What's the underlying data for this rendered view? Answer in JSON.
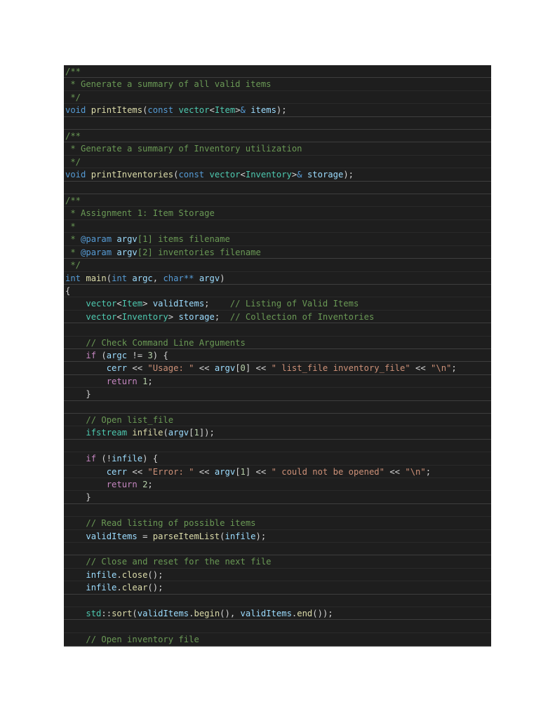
{
  "editor": {
    "language": "cpp",
    "theme_colors": {
      "background": "#1e1e1e",
      "comment": "#6a9955",
      "keyword": "#569cd6",
      "control": "#c586c0",
      "function": "#dcdcaa",
      "type": "#4ec9b0",
      "variable": "#9cdcfe",
      "string": "#ce9178",
      "number": "#b5cea8",
      "punctuation": "#d4d4d4"
    },
    "lines": [
      [
        [
          "comment",
          "/**"
        ]
      ],
      [
        [
          "comment",
          " * Generate a summary of all valid items"
        ]
      ],
      [
        [
          "comment",
          " */"
        ]
      ],
      [
        [
          "kw",
          "void"
        ],
        [
          "punct",
          " "
        ],
        [
          "fn",
          "printItems"
        ],
        [
          "punct",
          "("
        ],
        [
          "kw",
          "const"
        ],
        [
          "punct",
          " "
        ],
        [
          "type",
          "vector"
        ],
        [
          "punct",
          "<"
        ],
        [
          "type",
          "Item"
        ],
        [
          "punct",
          ">"
        ],
        [
          "kw",
          "&"
        ],
        [
          "punct",
          " "
        ],
        [
          "var",
          "items"
        ],
        [
          "punct",
          ");"
        ]
      ],
      [],
      [
        [
          "comment",
          "/**"
        ]
      ],
      [
        [
          "comment",
          " * Generate a summary of Inventory utilization"
        ]
      ],
      [
        [
          "comment",
          " */"
        ]
      ],
      [
        [
          "kw",
          "void"
        ],
        [
          "punct",
          " "
        ],
        [
          "fn",
          "printInventories"
        ],
        [
          "punct",
          "("
        ],
        [
          "kw",
          "const"
        ],
        [
          "punct",
          " "
        ],
        [
          "type",
          "vector"
        ],
        [
          "punct",
          "<"
        ],
        [
          "type",
          "Inventory"
        ],
        [
          "punct",
          ">"
        ],
        [
          "kw",
          "&"
        ],
        [
          "punct",
          " "
        ],
        [
          "var",
          "storage"
        ],
        [
          "punct",
          ");"
        ]
      ],
      [],
      [
        [
          "comment",
          "/**"
        ]
      ],
      [
        [
          "comment",
          " * Assignment 1: Item Storage"
        ]
      ],
      [
        [
          "comment",
          " *"
        ]
      ],
      [
        [
          "comment",
          " * "
        ],
        [
          "doc",
          "@param"
        ],
        [
          "punct",
          " "
        ],
        [
          "var",
          "argv"
        ],
        [
          "comment",
          "[1] items filename"
        ]
      ],
      [
        [
          "comment",
          " * "
        ],
        [
          "doc",
          "@param"
        ],
        [
          "punct",
          " "
        ],
        [
          "var",
          "argv"
        ],
        [
          "comment",
          "[2] inventories filename"
        ]
      ],
      [
        [
          "comment",
          " */"
        ]
      ],
      [
        [
          "kw",
          "int"
        ],
        [
          "punct",
          " "
        ],
        [
          "fn",
          "main"
        ],
        [
          "punct",
          "("
        ],
        [
          "kw",
          "int"
        ],
        [
          "punct",
          " "
        ],
        [
          "var",
          "argc"
        ],
        [
          "punct",
          ", "
        ],
        [
          "kw",
          "char**"
        ],
        [
          "punct",
          " "
        ],
        [
          "var",
          "argv"
        ],
        [
          "punct",
          ")"
        ]
      ],
      [
        [
          "punct",
          "{"
        ]
      ],
      [
        [
          "punct",
          "    "
        ],
        [
          "type",
          "vector"
        ],
        [
          "punct",
          "<"
        ],
        [
          "type",
          "Item"
        ],
        [
          "punct",
          "> "
        ],
        [
          "var",
          "validItems"
        ],
        [
          "punct",
          ";    "
        ],
        [
          "comment",
          "// Listing of Valid Items"
        ]
      ],
      [
        [
          "punct",
          "    "
        ],
        [
          "type",
          "vector"
        ],
        [
          "punct",
          "<"
        ],
        [
          "type",
          "Inventory"
        ],
        [
          "punct",
          "> "
        ],
        [
          "var",
          "storage"
        ],
        [
          "punct",
          ";  "
        ],
        [
          "comment",
          "// Collection of Inventories"
        ]
      ],
      [],
      [
        [
          "punct",
          "    "
        ],
        [
          "comment",
          "// Check Command Line Arguments"
        ]
      ],
      [
        [
          "punct",
          "    "
        ],
        [
          "ctrl",
          "if"
        ],
        [
          "punct",
          " ("
        ],
        [
          "var",
          "argc"
        ],
        [
          "punct",
          " != "
        ],
        [
          "num",
          "3"
        ],
        [
          "punct",
          ") {"
        ]
      ],
      [
        [
          "punct",
          "        "
        ],
        [
          "var",
          "cerr"
        ],
        [
          "punct",
          " << "
        ],
        [
          "str",
          "\"Usage: \""
        ],
        [
          "punct",
          " << "
        ],
        [
          "var",
          "argv"
        ],
        [
          "punct",
          "["
        ],
        [
          "num",
          "0"
        ],
        [
          "punct",
          "] << "
        ],
        [
          "str",
          "\" list_file inventory_file\""
        ],
        [
          "punct",
          " << "
        ],
        [
          "str",
          "\"\\n\""
        ],
        [
          "punct",
          ";"
        ]
      ],
      [
        [
          "punct",
          "        "
        ],
        [
          "ctrl",
          "return"
        ],
        [
          "punct",
          " "
        ],
        [
          "num",
          "1"
        ],
        [
          "punct",
          ";"
        ]
      ],
      [
        [
          "punct",
          "    }"
        ]
      ],
      [],
      [
        [
          "punct",
          "    "
        ],
        [
          "comment",
          "// Open list_file"
        ]
      ],
      [
        [
          "punct",
          "    "
        ],
        [
          "type",
          "ifstream"
        ],
        [
          "punct",
          " "
        ],
        [
          "fn",
          "infile"
        ],
        [
          "punct",
          "("
        ],
        [
          "var",
          "argv"
        ],
        [
          "punct",
          "["
        ],
        [
          "num",
          "1"
        ],
        [
          "punct",
          "]);"
        ]
      ],
      [],
      [
        [
          "punct",
          "    "
        ],
        [
          "ctrl",
          "if"
        ],
        [
          "punct",
          " (!"
        ],
        [
          "var",
          "infile"
        ],
        [
          "punct",
          ") {"
        ]
      ],
      [
        [
          "punct",
          "        "
        ],
        [
          "var",
          "cerr"
        ],
        [
          "punct",
          " << "
        ],
        [
          "str",
          "\"Error: \""
        ],
        [
          "punct",
          " << "
        ],
        [
          "var",
          "argv"
        ],
        [
          "punct",
          "["
        ],
        [
          "num",
          "1"
        ],
        [
          "punct",
          "] << "
        ],
        [
          "str",
          "\" could not be opened\""
        ],
        [
          "punct",
          " << "
        ],
        [
          "str",
          "\"\\n\""
        ],
        [
          "punct",
          ";"
        ]
      ],
      [
        [
          "punct",
          "        "
        ],
        [
          "ctrl",
          "return"
        ],
        [
          "punct",
          " "
        ],
        [
          "num",
          "2"
        ],
        [
          "punct",
          ";"
        ]
      ],
      [
        [
          "punct",
          "    }"
        ]
      ],
      [],
      [
        [
          "punct",
          "    "
        ],
        [
          "comment",
          "// Read listing of possible items"
        ]
      ],
      [
        [
          "punct",
          "    "
        ],
        [
          "var",
          "validItems"
        ],
        [
          "punct",
          " = "
        ],
        [
          "fn",
          "parseItemList"
        ],
        [
          "punct",
          "("
        ],
        [
          "var",
          "infile"
        ],
        [
          "punct",
          ");"
        ]
      ],
      [],
      [
        [
          "punct",
          "    "
        ],
        [
          "comment",
          "// Close and reset for the next file"
        ]
      ],
      [
        [
          "punct",
          "    "
        ],
        [
          "var",
          "infile"
        ],
        [
          "punct",
          "."
        ],
        [
          "fn",
          "close"
        ],
        [
          "punct",
          "();"
        ]
      ],
      [
        [
          "punct",
          "    "
        ],
        [
          "var",
          "infile"
        ],
        [
          "punct",
          "."
        ],
        [
          "fn",
          "clear"
        ],
        [
          "punct",
          "();"
        ]
      ],
      [],
      [
        [
          "punct",
          "    "
        ],
        [
          "type",
          "std"
        ],
        [
          "punct",
          "::"
        ],
        [
          "fn",
          "sort"
        ],
        [
          "punct",
          "("
        ],
        [
          "var",
          "validItems"
        ],
        [
          "punct",
          "."
        ],
        [
          "fn",
          "begin"
        ],
        [
          "punct",
          "(), "
        ],
        [
          "var",
          "validItems"
        ],
        [
          "punct",
          "."
        ],
        [
          "fn",
          "end"
        ],
        [
          "punct",
          "());"
        ]
      ],
      [],
      [
        [
          "punct",
          "    "
        ],
        [
          "comment",
          "// Open inventory file"
        ]
      ]
    ]
  }
}
